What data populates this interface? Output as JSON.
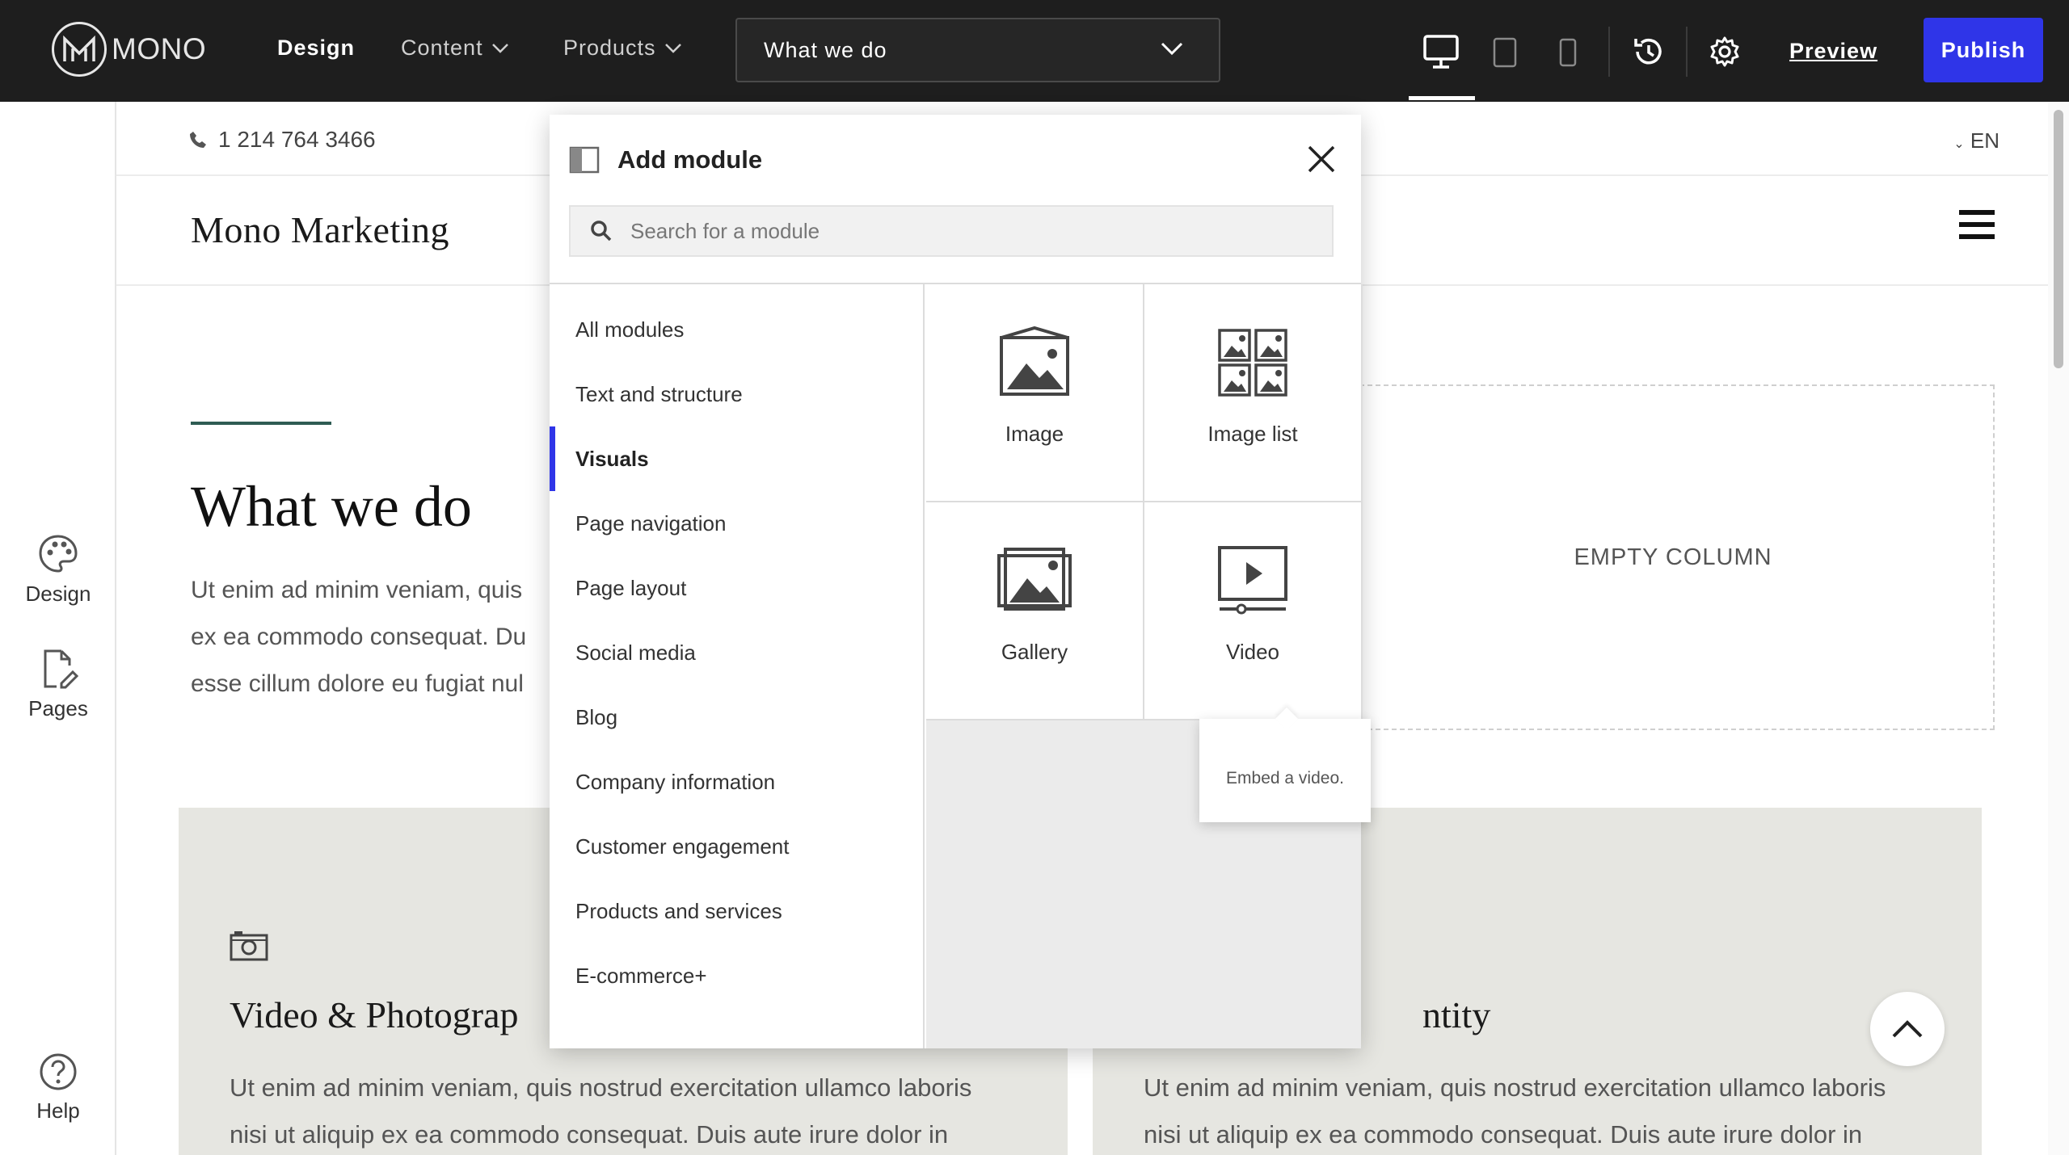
{
  "app": {
    "logo_text": "MONO",
    "nav": {
      "design": "Design",
      "content": "Content",
      "products": "Products"
    },
    "page_selector": "What we do",
    "preview": "Preview",
    "publish": "Publish"
  },
  "sidebar": {
    "design": "Design",
    "pages": "Pages",
    "help": "Help"
  },
  "site": {
    "phone": "1 214 764 3466",
    "language": "EN",
    "name": "Mono Marketing",
    "hero_title": "What we do",
    "hero_text": "Ut enim ad minim veniam, quis\nex ea commodo consequat. Du\nesse cillum dolore eu fugiat nul",
    "empty_column": "EMPTY COLUMN",
    "card1_title": "Video & Photograp",
    "card2_title": "ntity",
    "card_text": "Ut enim ad minim veniam, quis nostrud exercitation ullamco laboris\nnisi ut aliquip ex ea commodo consequat. Duis aute irure dolor in"
  },
  "panel": {
    "title": "Add module",
    "search_placeholder": "Search for a module",
    "categories": [
      "All modules",
      "Text and structure",
      "Visuals",
      "Page navigation",
      "Page layout",
      "Social media",
      "Blog",
      "Company information",
      "Customer engagement",
      "Products and services",
      "E-commerce+"
    ],
    "active_category": "Visuals",
    "modules": [
      "Image",
      "Image list",
      "Gallery",
      "Video"
    ],
    "tooltip": "Embed a video."
  },
  "colors": {
    "topbar": "#1e1e1e",
    "publish": "#2f35e8",
    "accent_line": "#2e5c53",
    "card_bg": "#e6e6e1"
  }
}
